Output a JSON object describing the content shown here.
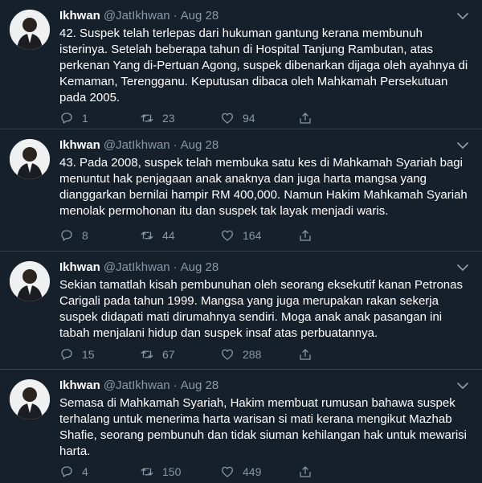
{
  "tweets": [
    {
      "name": "Ikhwan",
      "handle": "@JatIkhwan",
      "separator": "·",
      "date": "Aug 28",
      "text": "42. Suspek telah terlepas dari hukuman gantung kerana membunuh isterinya. Setelah beberapa tahun di Hospital Tanjung Rambutan, atas perkenan Yang di-Pertuan Agong, suspek dibenarkan dijaga oleh ayahnya di Kemaman, Terengganu. Keputusan dibaca oleh Mahkamah Persekutuan pada 2005.",
      "replies": "1",
      "retweets": "23",
      "likes": "94"
    },
    {
      "name": "Ikhwan",
      "handle": "@JatIkhwan",
      "separator": "·",
      "date": "Aug 28",
      "text": "43. Pada 2008, suspek telah membuka satu kes di Mahkamah Syariah bagi menuntut hak penjagaan anak anaknya dan juga harta mangsa yang dianggarkan bernilai hampir RM 400,000. Namun Hakim Mahkamah Syariah menolak permohonan itu dan suspek tak layak menjadi waris.",
      "replies": "8",
      "retweets": "44",
      "likes": "164"
    },
    {
      "name": "Ikhwan",
      "handle": "@JatIkhwan",
      "separator": "·",
      "date": "Aug 28",
      "text": "Sekian tamatlah kisah pembunuhan oleh seorang eksekutif kanan Petronas Carigali pada tahun 1999. Mangsa yang juga merupakan rakan sekerja suspek didapati mati dirumahnya sendiri. Moga anak anak pasangan ini tabah menjalani hidup dan suspek insaf atas perbuatannya.",
      "replies": "15",
      "retweets": "67",
      "likes": "288"
    },
    {
      "name": "Ikhwan",
      "handle": "@JatIkhwan",
      "separator": "·",
      "date": "Aug 28",
      "text": "Semasa di Mahkamah Syariah, Hakim membuat rumusan bahawa suspek terhalang untuk menerima harta warisan si mati kerana mengikut Mazhab Shafie, seorang pembunuh dan tidak siuman kehilangan hak untuk mewarisi harta.",
      "replies": "4",
      "retweets": "150",
      "likes": "449"
    }
  ],
  "theme": {
    "background": "#15202b",
    "border": "#38444d",
    "muted": "#8899a6",
    "text": "#ffffff"
  },
  "icons": [
    "avatar-photo",
    "chevron-down-icon",
    "reply-icon",
    "retweet-icon",
    "like-icon",
    "share-icon"
  ]
}
